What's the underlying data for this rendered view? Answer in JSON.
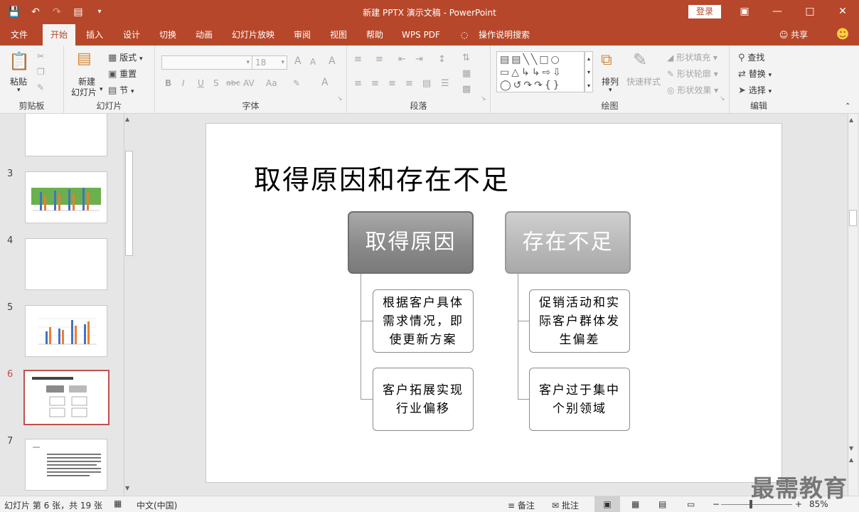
{
  "window": {
    "title": "新建 PPTX 演示文稿 - PowerPoint",
    "login": "登录"
  },
  "qat": {
    "save_icon": "save-icon",
    "undo_icon": "undo-icon",
    "redo_icon": "redo-icon"
  },
  "tabs": [
    "文件",
    "开始",
    "插入",
    "设计",
    "切换",
    "动画",
    "幻灯片放映",
    "审阅",
    "视图",
    "帮助",
    "WPS PDF",
    "操作说明搜索"
  ],
  "share": "共享",
  "ribbon": {
    "clipboard": {
      "label": "剪贴板",
      "paste": "粘贴"
    },
    "slides": {
      "label": "幻灯片",
      "new_slide": "新建",
      "new_slide2": "幻灯片",
      "layout": "版式",
      "reset": "重置",
      "section": "节"
    },
    "font": {
      "label": "字体",
      "size": "18",
      "bold": "B",
      "italic": "I",
      "underline": "U",
      "shadow": "S",
      "strike": "abc",
      "spacing": "AV",
      "case": "Aa",
      "grow": "A",
      "shrink": "A",
      "clear": "A"
    },
    "paragraph": {
      "label": "段落"
    },
    "drawing": {
      "label": "绘图",
      "arrange": "排列",
      "quick_styles": "快速样式",
      "fill": "形状填充",
      "outline": "形状轮廓",
      "effects": "形状效果"
    },
    "editing": {
      "label": "编辑",
      "find": "查找",
      "replace": "替换",
      "select": "选择"
    }
  },
  "thumbs": [
    {
      "num": "3"
    },
    {
      "num": "4"
    },
    {
      "num": "5"
    },
    {
      "num": "6"
    },
    {
      "num": "7"
    }
  ],
  "slide": {
    "title": "取得原因和存在不足",
    "heads": [
      "取得原因",
      "存在不足"
    ],
    "left_items": [
      "根据客户具体需求情况，即使更新方案",
      "客户拓展实现行业偏移"
    ],
    "right_items": [
      "促销活动和实际客户群体发生偏差",
      "客户过于集中个别领域"
    ]
  },
  "status": {
    "slide_info": "幻灯片 第 6 张，共 19 张",
    "language": "中文(中国)",
    "notes": "备注",
    "comments": "批注",
    "zoom": "85%"
  },
  "watermark": "最需教育"
}
